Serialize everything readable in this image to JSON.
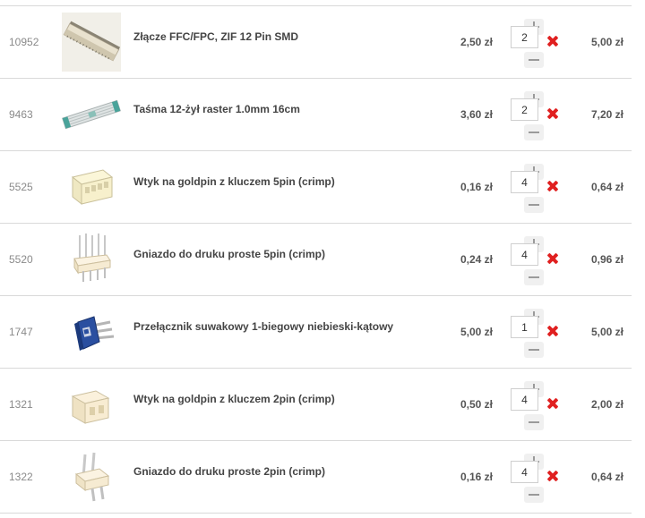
{
  "cart": {
    "items": [
      {
        "code": "10952",
        "name": "Złącze FFC/FPC, ZIF 12 Pin SMD",
        "price": "2,50 zł",
        "quantity": "2",
        "total": "5,00 zł",
        "image_icon": "ffc-connector-icon"
      },
      {
        "code": "9463",
        "name": "Taśma 12-żył raster 1.0mm 16cm",
        "price": "3,60 zł",
        "quantity": "2",
        "total": "7,20 zł",
        "image_icon": "ribbon-cable-icon"
      },
      {
        "code": "5525",
        "name": "Wtyk na goldpin z kluczem 5pin (crimp)",
        "price": "0,16 zł",
        "quantity": "4",
        "total": "0,64 zł",
        "image_icon": "crimp-housing-icon"
      },
      {
        "code": "5520",
        "name": "Gniazdo do druku proste 5pin (crimp)",
        "price": "0,24 zł",
        "quantity": "4",
        "total": "0,96 zł",
        "image_icon": "pcb-header-icon"
      },
      {
        "code": "1747",
        "name": "Przełącznik suwakowy 1-biegowy niebieski-kątowy",
        "price": "5,00 zł",
        "quantity": "1",
        "total": "5,00 zł",
        "image_icon": "slide-switch-icon"
      },
      {
        "code": "1321",
        "name": "Wtyk na goldpin z kluczem 2pin (crimp)",
        "price": "0,50 zł",
        "quantity": "4",
        "total": "2,00 zł",
        "image_icon": "crimp-housing-icon"
      },
      {
        "code": "1322",
        "name": "Gniazdo do druku proste 2pin (crimp)",
        "price": "0,16 zł",
        "quantity": "4",
        "total": "0,64 zł",
        "image_icon": "pcb-header-icon"
      }
    ],
    "colors": {
      "remove": "#e02020",
      "divider": "#d9d9d9",
      "text": "#444444"
    }
  }
}
